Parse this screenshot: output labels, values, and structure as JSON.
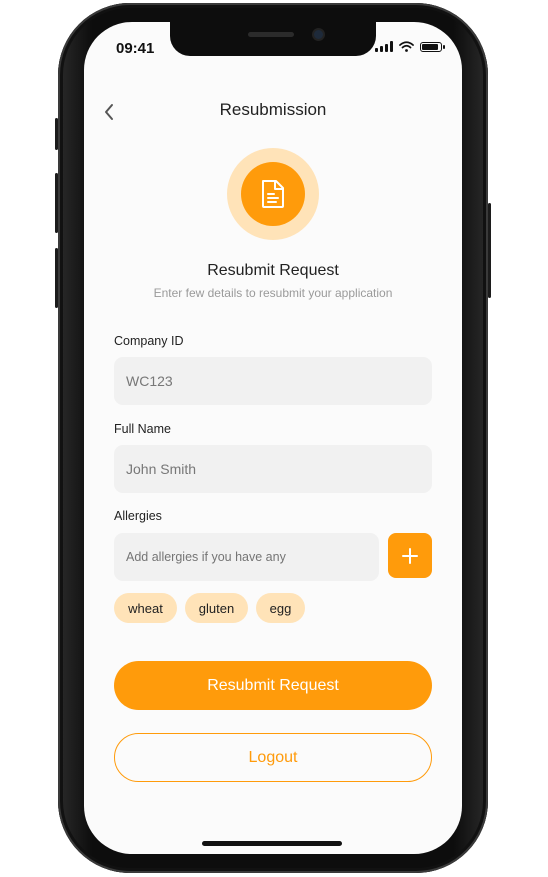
{
  "status_bar": {
    "time": "09:41"
  },
  "header": {
    "title": "Resubmission",
    "back_icon": "chevron-left-icon"
  },
  "hero": {
    "icon": "document-icon",
    "title": "Resubmit Request",
    "subtitle": "Enter few details to resubmit your application"
  },
  "form": {
    "company_id": {
      "label": "Company ID",
      "value": "WC123"
    },
    "full_name": {
      "label": "Full Name",
      "value": "John Smith"
    },
    "allergies": {
      "label": "Allergies",
      "placeholder": "Add allergies if you have any",
      "add_icon": "plus-icon",
      "tags": [
        "wheat",
        "gluten",
        "egg"
      ]
    }
  },
  "actions": {
    "primary_label": "Resubmit Request",
    "secondary_label": "Logout"
  },
  "colors": {
    "accent": "#ff9b0b",
    "accent_light": "#ffe3b8",
    "field_bg": "#f1f1f1"
  }
}
